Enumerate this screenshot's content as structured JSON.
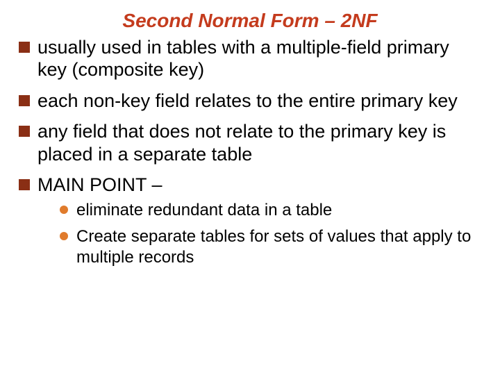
{
  "title": "Second Normal Form – 2NF",
  "bullets": [
    {
      "text": "usually used in tables with a multiple-field primary key (composite key)"
    },
    {
      "text": "each non-key field relates to the entire primary key"
    },
    {
      "text": "any field that does not relate to the primary key is placed in a separate table"
    },
    {
      "text": "MAIN POINT –"
    }
  ],
  "subbullets": [
    {
      "text": "eliminate redundant data in a table"
    },
    {
      "text": "Create separate tables for sets of values that apply to multiple records"
    }
  ]
}
